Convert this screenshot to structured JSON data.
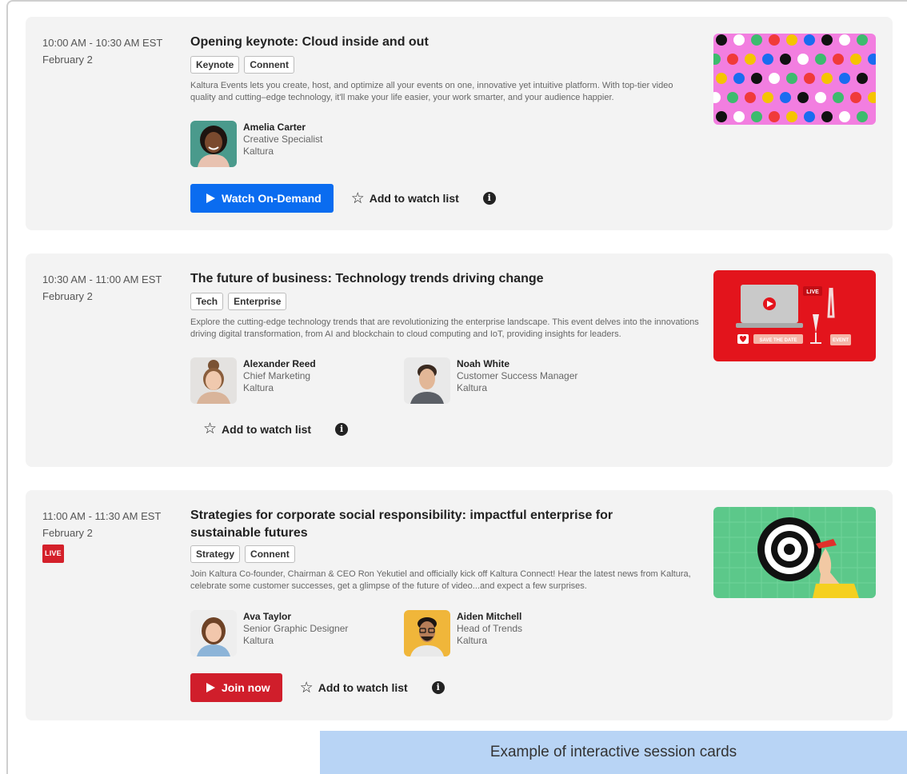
{
  "sessions": [
    {
      "time": "10:00 AM - 10:30 AM EST",
      "date": "February 2",
      "title": "Opening keynote: Cloud inside and out",
      "tags": [
        "Keynote",
        "Connent"
      ],
      "description": "Kaltura Events lets you create, host, and optimize all your events on one, innovative yet intuitive platform. With top-tier video quality and cutting–edge technology, it'll make your life easier, your work smarter, and your audience happier.",
      "speakers": [
        {
          "name": "Amelia Carter",
          "role": "Creative Specialist",
          "company": "Kaltura"
        }
      ],
      "primary_action": "Watch On-Demand",
      "watchlist_label": "Add to watch list"
    },
    {
      "time": "10:30 AM - 11:00 AM EST",
      "date": "February 2",
      "title": "The future of business: Technology trends driving change",
      "tags": [
        "Tech",
        "Enterprise"
      ],
      "description": "Explore the cutting-edge technology trends that are revolutionizing the enterprise landscape. This event delves into the innovations driving digital transformation, from AI and blockchain to cloud computing and IoT, providing insights for leaders.",
      "speakers": [
        {
          "name": "Alexander Reed",
          "role": "Chief Marketing",
          "company": "Kaltura"
        },
        {
          "name": "Noah White",
          "role": "Customer Success Manager",
          "company": "Kaltura"
        }
      ],
      "watchlist_label": "Add to watch list",
      "thumb_text": {
        "live": "LIVE",
        "save": "SAVE THE DATE",
        "event": "EVENT"
      }
    },
    {
      "time": "11:00 AM - 11:30 AM EST",
      "date": "February 2",
      "live_label": "LIVE",
      "title": "Strategies for corporate social responsibility: impactful enterprise for sustainable futures",
      "tags": [
        "Strategy",
        "Connent"
      ],
      "description": "Join Kaltura Co-founder, Chairman & CEO Ron Yekutiel and officially kick off Kaltura Connect! Hear the latest news from Kaltura, celebrate some customer successes, get a glimpse of the future of video...and expect a few surprises.",
      "speakers": [
        {
          "name": "Ava Taylor",
          "role": "Senior Graphic Designer",
          "company": "Kaltura"
        },
        {
          "name": "Aiden Mitchell",
          "role": "Head of Trends",
          "company": "Kaltura"
        }
      ],
      "primary_action": "Join now",
      "watchlist_label": "Add to watch list"
    }
  ],
  "caption": "Example of interactive session cards",
  "colors": {
    "card_bg": "#f3f3f3",
    "blue_button": "#0a6cf0",
    "red_button": "#d01e2b",
    "caption_bg": "#b8d4f5",
    "live_badge": "#d4202a"
  },
  "icons": {
    "play": "play-icon",
    "star": "star-outline-icon",
    "info": "info-icon"
  }
}
